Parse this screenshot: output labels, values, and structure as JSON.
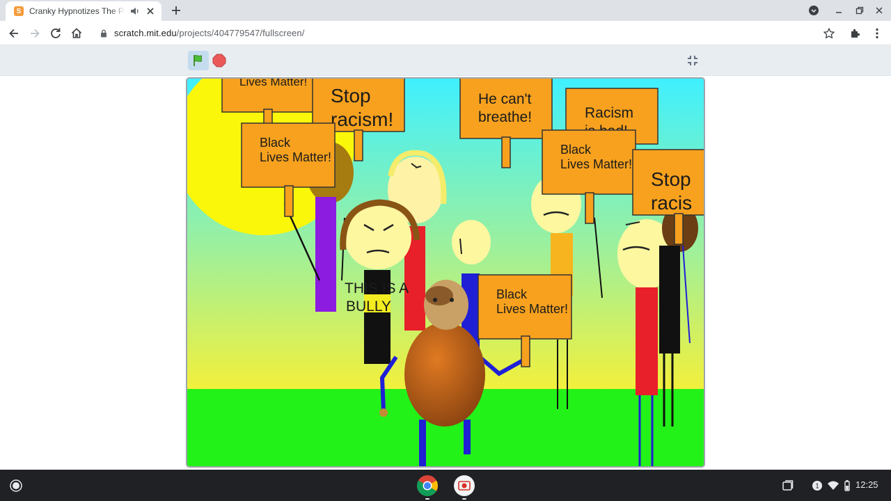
{
  "browser": {
    "tab": {
      "favicon": "scratch-cat-icon",
      "title": "Cranky Hypnotizes The Police",
      "audio_icon": "speaker-icon",
      "close_icon": "close-icon"
    },
    "new_tab_icon": "plus-icon",
    "window_controls": [
      "account-circle-icon",
      "minimize-icon",
      "restore-icon",
      "close-icon"
    ],
    "toolbar": {
      "back_icon": "arrow-left-icon",
      "forward_icon": "arrow-right-icon",
      "reload_icon": "reload-icon",
      "home_icon": "home-icon",
      "extensions_icon": "puzzle-icon",
      "menu_icon": "kebab-menu-icon"
    },
    "address_bar": {
      "lock_icon": "lock-icon",
      "host": "scratch.mit.edu",
      "path": "/projects/404779547/fullscreen/",
      "bookmark_icon": "star-icon"
    }
  },
  "player": {
    "green_flag_icon": "green-flag-icon",
    "stop_icon": "stop-sign-icon",
    "exit_fullscreen_icon": "exit-fullscreen-icon"
  },
  "stage": {
    "signs": [
      {
        "id": "sign-top-left",
        "lines": [
          "Lives Matter!"
        ]
      },
      {
        "id": "sign-stop-1",
        "lines": [
          "Stop",
          "racism!"
        ]
      },
      {
        "id": "sign-black-1",
        "lines": [
          "Black",
          "Lives Matter!"
        ]
      },
      {
        "id": "sign-cant-breathe",
        "lines": [
          "He can't",
          "breathe!"
        ]
      },
      {
        "id": "sign-racism-bad",
        "lines": [
          "Racism",
          "is bad!"
        ]
      },
      {
        "id": "sign-black-2",
        "lines": [
          "Black",
          "Lives Matter!"
        ]
      },
      {
        "id": "sign-stop-2",
        "lines": [
          "Stop",
          "racis"
        ]
      },
      {
        "id": "sign-black-3",
        "lines": [
          "Black",
          "Lives Matter!"
        ]
      }
    ],
    "speech": [
      "THIS IS A",
      "BULLY"
    ],
    "colors": {
      "sky_top": "#3ff0ff",
      "sky_bottom": "#f4f03a",
      "grass": "#22f218",
      "sun": "#fbf70a",
      "sign": "#f7a11e"
    }
  },
  "shelf": {
    "launcher_icon": "launcher-circle-icon",
    "apps": [
      "chrome-icon",
      "screen-capture-icon"
    ],
    "tray": [
      "overview-icon",
      "notification-count-icon",
      "wifi-icon",
      "battery-icon"
    ],
    "notification_count": "1",
    "clock": "12:25"
  }
}
